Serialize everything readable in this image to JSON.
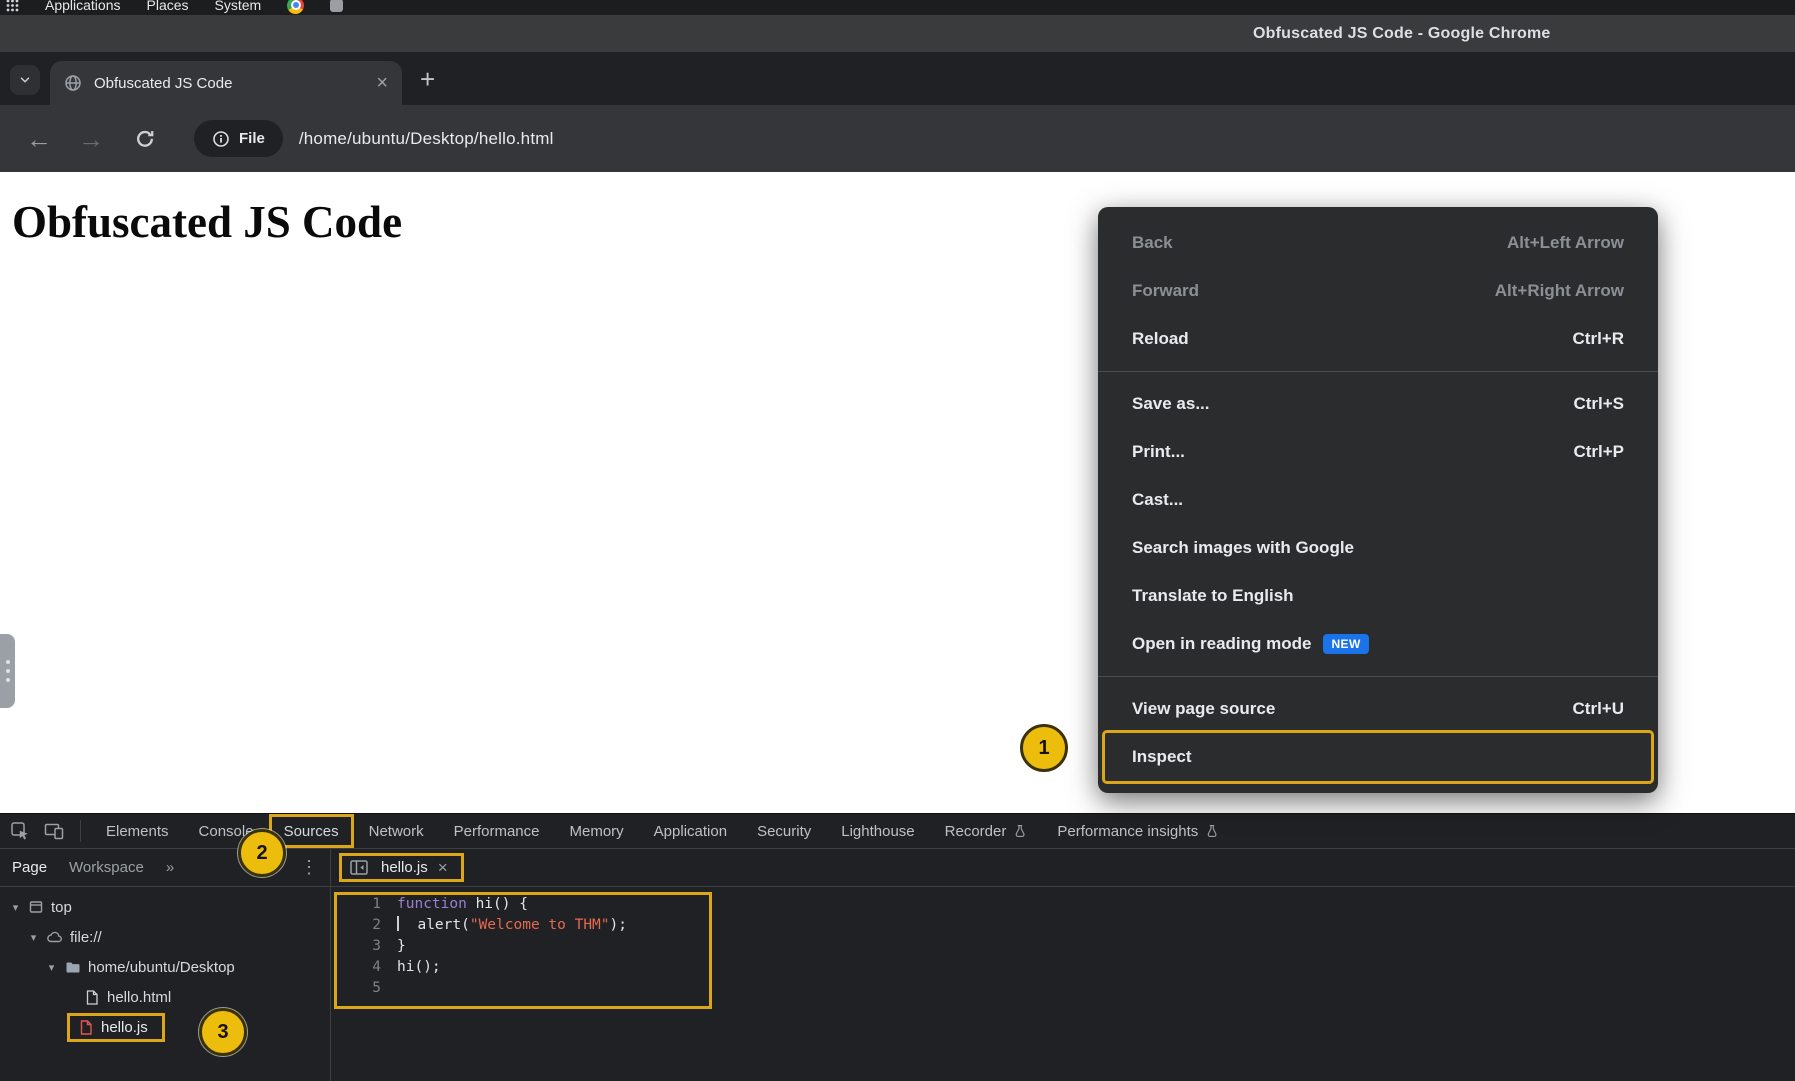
{
  "colors": {
    "annotation_yellow": "#dba617",
    "annotation_fill": "#edbd0e",
    "new_badge_blue": "#1a73e8",
    "keyword_purple": "#9a7fd5",
    "string_red": "#e5694f",
    "js_file_red": "#e2574c"
  },
  "system_bar": {
    "menus": [
      "Applications",
      "Places",
      "System"
    ]
  },
  "window_title": "Obfuscated JS Code - Google Chrome",
  "browser": {
    "tab_title": "Obfuscated JS Code",
    "close_tab": "×",
    "new_tab": "+",
    "back": "←",
    "forward": "→",
    "file_chip": "File",
    "url": "/home/ubuntu/Desktop/hello.html"
  },
  "page": {
    "heading": "Obfuscated JS Code"
  },
  "context_menu": {
    "items": [
      {
        "label": "Back",
        "shortcut": "Alt+Left Arrow"
      },
      {
        "label": "Forward",
        "shortcut": "Alt+Right Arrow"
      },
      {
        "label": "Reload",
        "shortcut": "Ctrl+R"
      },
      {
        "label": "Save as...",
        "shortcut": "Ctrl+S"
      },
      {
        "label": "Print...",
        "shortcut": "Ctrl+P"
      },
      {
        "label": "Cast...",
        "shortcut": ""
      },
      {
        "label": "Search images with Google",
        "shortcut": ""
      },
      {
        "label": "Translate to English",
        "shortcut": ""
      },
      {
        "label": "Open in reading mode",
        "shortcut": "",
        "badge": "NEW"
      },
      {
        "label": "View page source",
        "shortcut": "Ctrl+U"
      },
      {
        "label": "Inspect",
        "shortcut": ""
      }
    ]
  },
  "annotations": {
    "step1": "1",
    "step2": "2",
    "step3": "3"
  },
  "devtools": {
    "tabs": [
      "Elements",
      "Console",
      "Sources",
      "Network",
      "Performance",
      "Memory",
      "Application",
      "Security",
      "Lighthouse",
      "Recorder",
      "Performance insights"
    ],
    "active_tab": "Sources",
    "sidebar": {
      "page_tab": "Page",
      "workspace_tab": "Workspace",
      "overflow": "»",
      "more": "⋮"
    },
    "tree": {
      "top": "top",
      "file_scheme": "file://",
      "folder": "home/ubuntu/Desktop",
      "file_html": "hello.html",
      "file_js": "hello.js",
      "caret": "▾"
    },
    "editor": {
      "tab_label": "hello.js",
      "close": "×",
      "lines": [
        {
          "no": "1",
          "kw": "function",
          "rest": " hi() {"
        },
        {
          "no": "2",
          "pre": "  alert(",
          "str": "\"Welcome to THM\"",
          "rest": ");"
        },
        {
          "no": "3",
          "pre": "}"
        },
        {
          "no": "4",
          "pre": "hi();"
        },
        {
          "no": "5",
          "pre": ""
        }
      ]
    }
  }
}
